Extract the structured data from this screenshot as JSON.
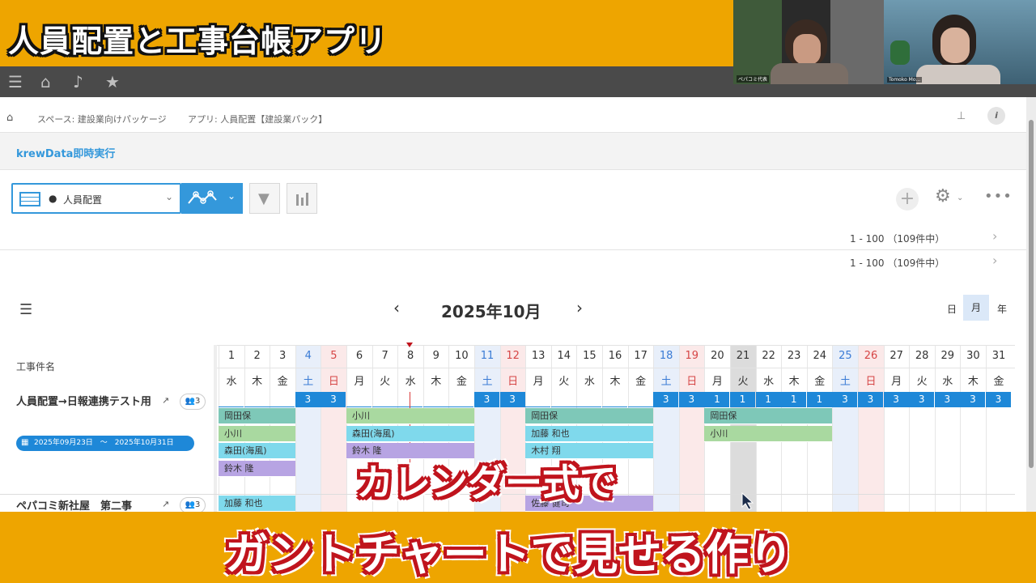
{
  "banner": {
    "title": "人員配置と工事台帳アプリ"
  },
  "webcams": {
    "left_label": "ペパコミ代表",
    "right_label": "Tomoko Mo..."
  },
  "breadcrumb": {
    "space": "スペース: 建設業向けパッケージ",
    "app": "アプリ: 人員配置【建設業パック】"
  },
  "krew": {
    "label": "krewData即時実行"
  },
  "toolbar": {
    "view_name": "人員配置"
  },
  "pagination": {
    "top": "1 - 100 （109件中）",
    "bottom": "1 - 100 （109件中）"
  },
  "calendar": {
    "month_label": "2025年10月",
    "view_modes": [
      "日",
      "月",
      "年"
    ],
    "active_mode": "月",
    "row_header": "工事件名",
    "days": [
      "1",
      "2",
      "3",
      "4",
      "5",
      "6",
      "7",
      "8",
      "9",
      "10",
      "11",
      "12",
      "13",
      "14",
      "15",
      "16",
      "17",
      "18",
      "19",
      "20",
      "21",
      "22",
      "23",
      "24",
      "25",
      "26",
      "27",
      "28",
      "29",
      "30",
      "31"
    ],
    "weekdays": [
      "水",
      "木",
      "金",
      "土",
      "日",
      "月",
      "火",
      "水",
      "木",
      "金",
      "土",
      "日",
      "月",
      "火",
      "水",
      "木",
      "金",
      "土",
      "日",
      "月",
      "火",
      "水",
      "木",
      "金",
      "土",
      "日",
      "月",
      "火",
      "水",
      "木",
      "金"
    ],
    "counts": [
      "",
      "",
      "",
      "3",
      "3",
      "",
      "",
      "",
      "",
      "",
      "3",
      "3",
      "",
      "",
      "",
      "",
      "",
      "3",
      "3",
      "1",
      "1",
      "1",
      "1",
      "1",
      "3",
      "3",
      "3",
      "3",
      "3",
      "3",
      "3"
    ],
    "projects": [
      {
        "name": "人員配置→日報連携テスト用",
        "members": "3",
        "period": "2025年09月23日　～　2025年10月31日"
      },
      {
        "name": "ペパコミ新社屋　第二事",
        "members": "3"
      }
    ],
    "assignments": [
      {
        "label": "岡田保",
        "color": "#7ec8b8"
      },
      {
        "label": "小川",
        "color": "#a9d9a0"
      },
      {
        "label": "森田(海風)",
        "color": "#7fd9ec"
      },
      {
        "label": "鈴木 隆",
        "color": "#b7a4e3"
      },
      {
        "label": "小川",
        "color": "#a9d9a0"
      },
      {
        "label": "森田(海風)",
        "color": "#7fd9ec"
      },
      {
        "label": "鈴木 隆",
        "color": "#b7a4e3"
      },
      {
        "label": "岡田保",
        "color": "#7ec8b8"
      },
      {
        "label": "加藤 和也",
        "color": "#7fd9ec"
      },
      {
        "label": "木村 翔",
        "color": "#7fd9ec"
      },
      {
        "label": "岡田保",
        "color": "#7ec8b8"
      },
      {
        "label": "小川",
        "color": "#a9d9a0"
      },
      {
        "label": "加藤 和也",
        "color": "#7fd9ec"
      },
      {
        "label": "佐藤 健司",
        "color": "#b7a4e3"
      }
    ]
  },
  "captions": {
    "line1": "カレンダー式で",
    "line2": "ガントチャートで見せる作り"
  }
}
